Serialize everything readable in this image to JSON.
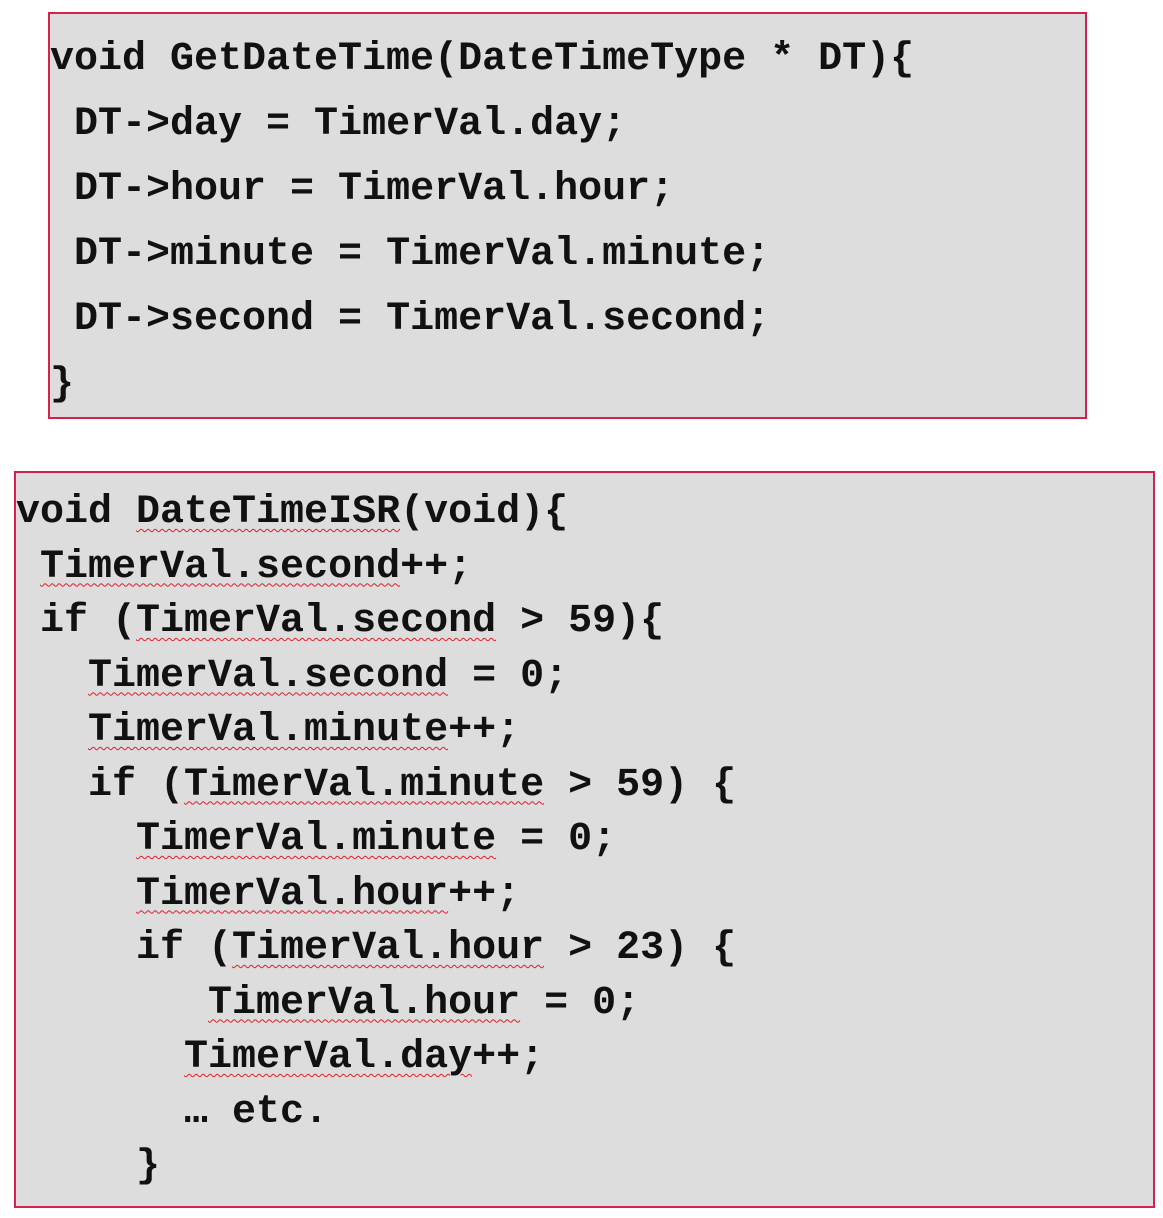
{
  "get_date_time": {
    "lines": [
      {
        "indent": "",
        "text": "void GetDateTime(DateTimeType * DT){"
      },
      {
        "indent": " ",
        "text": "DT->day = TimerVal.day;"
      },
      {
        "indent": " ",
        "text": "DT->hour = TimerVal.hour;"
      },
      {
        "indent": " ",
        "text": "DT->minute = TimerVal.minute;"
      },
      {
        "indent": " ",
        "text": "DT->second = TimerVal.second;"
      },
      {
        "indent": "",
        "text": "}"
      }
    ]
  },
  "date_time_isr": {
    "lines": [
      {
        "indent": "",
        "parts": [
          "void ",
          "DateTimeISR",
          "(void){"
        ]
      },
      {
        "indent": " ",
        "parts": [
          "",
          "TimerVal.second",
          "++;"
        ]
      },
      {
        "indent": " ",
        "parts": [
          "if (",
          "TimerVal.second",
          " > 59){"
        ]
      },
      {
        "indent": "   ",
        "parts": [
          "",
          "TimerVal.second",
          " = 0;"
        ]
      },
      {
        "indent": "   ",
        "parts": [
          "",
          "TimerVal.minute",
          "++;"
        ]
      },
      {
        "indent": "   ",
        "parts": [
          "if (",
          "TimerVal.minute",
          " > 59) {"
        ]
      },
      {
        "indent": "     ",
        "parts": [
          "",
          "TimerVal.minute",
          " = 0;"
        ]
      },
      {
        "indent": "     ",
        "parts": [
          "",
          "TimerVal.hour",
          "++;"
        ]
      },
      {
        "indent": "     ",
        "parts": [
          "if (",
          "TimerVal.hour",
          " > 23) {"
        ]
      },
      {
        "indent": "        ",
        "parts": [
          "",
          "TimerVal.hour",
          " = 0;"
        ]
      },
      {
        "indent": "       ",
        "parts": [
          "",
          "TimerVal.day",
          "++;"
        ]
      },
      {
        "indent": "       ",
        "parts": [
          "",
          "…",
          " etc."
        ]
      },
      {
        "indent": "     ",
        "parts": [
          "",
          "}",
          ""
        ]
      }
    ]
  },
  "colors": {
    "box_background": "#dddddd",
    "box_border": "#d6214f",
    "spellcheck_underline": "#e0202a",
    "text": "#111111"
  }
}
